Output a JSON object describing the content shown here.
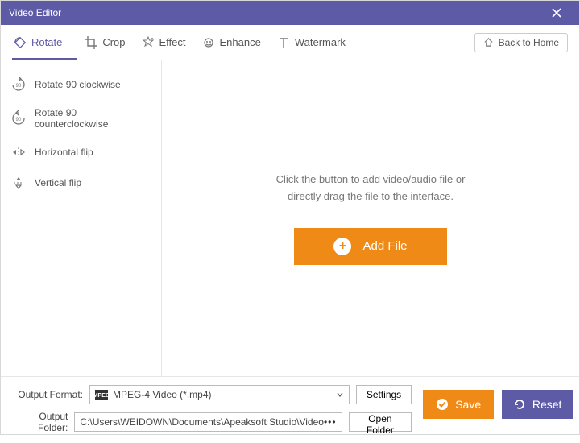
{
  "titlebar": {
    "title": "Video Editor"
  },
  "toolbar": {
    "tabs": {
      "rotate": "Rotate",
      "crop": "Crop",
      "effect": "Effect",
      "enhance": "Enhance",
      "watermark": "Watermark"
    },
    "back_home": "Back to Home"
  },
  "sidebar": {
    "rotate_cw": "Rotate 90 clockwise",
    "rotate_ccw": "Rotate 90 counterclockwise",
    "hflip": "Horizontal flip",
    "vflip": "Vertical flip"
  },
  "center": {
    "line1": "Click the button to add video/audio file or",
    "line2": "directly drag the file to the interface.",
    "add_file": "Add File"
  },
  "bottom": {
    "output_format_label": "Output Format:",
    "output_format_value": "MPEG-4 Video (*.mp4)",
    "settings": "Settings",
    "output_folder_label": "Output Folder:",
    "output_folder_value": "C:\\Users\\WEIDOWN\\Documents\\Apeaksoft Studio\\Video",
    "open_folder": "Open Folder",
    "save": "Save",
    "reset": "Reset"
  }
}
